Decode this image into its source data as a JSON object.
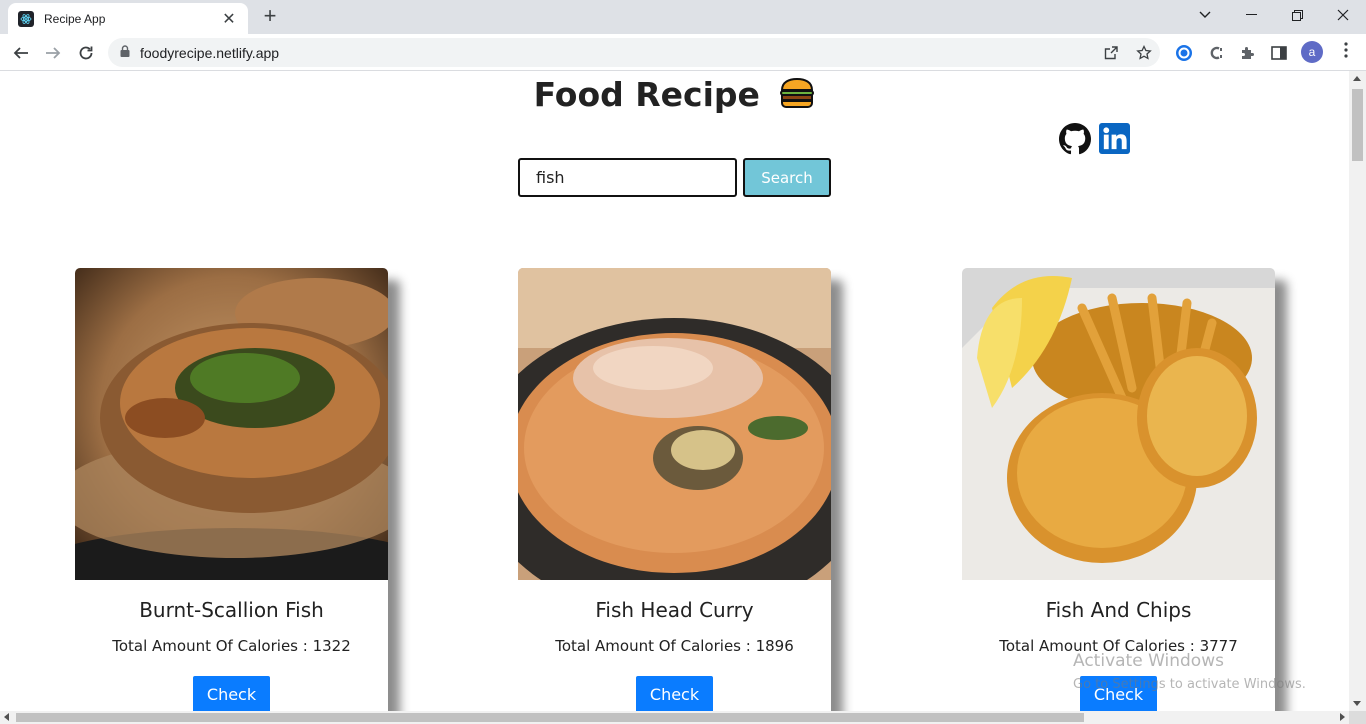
{
  "browser": {
    "tab_title": "Recipe App",
    "url": "foodyrecipe.netlify.app",
    "profile_initial": "a"
  },
  "page": {
    "title": "Food Recipe",
    "search": {
      "value": "fish",
      "button_label": "Search"
    },
    "social": [
      "github-icon",
      "linkedin-icon"
    ],
    "recipes": [
      {
        "name": "Burnt-Scallion Fish",
        "calories_label": "Total Amount Of Calories : 1322",
        "button_label": "Check"
      },
      {
        "name": "Fish Head Curry",
        "calories_label": "Total Amount Of Calories : 1896",
        "button_label": "Check"
      },
      {
        "name": "Fish And Chips",
        "calories_label": "Total Amount Of Calories : 3777",
        "button_label": "Check"
      }
    ]
  },
  "watermark": {
    "line1": "Activate Windows",
    "line2": "Go to Settings to activate Windows."
  },
  "colors": {
    "search_button": "#72c6d8",
    "check_button": "#0a7cff",
    "linkedin": "#0a66c2"
  }
}
